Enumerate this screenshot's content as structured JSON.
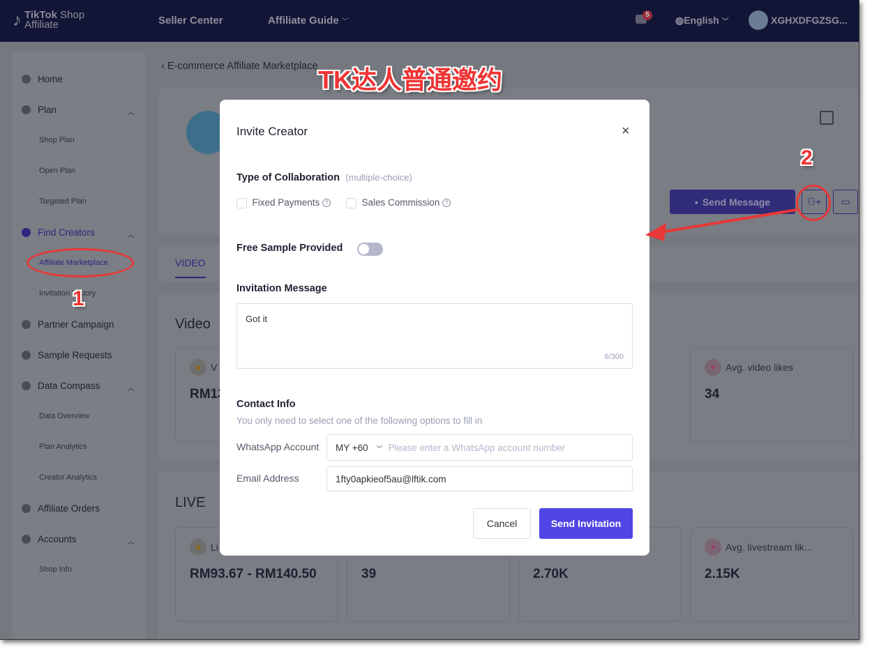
{
  "header": {
    "logo_line1": "TikTok",
    "logo_shop": "Shop",
    "logo_line2": "Affiliate",
    "nav": [
      "Seller Center",
      "Affiliate Guide"
    ],
    "notification_count": "5",
    "language": "English",
    "username": "XGHXDFGZSG..."
  },
  "sidebar": {
    "items": [
      {
        "label": "Home",
        "type": "main"
      },
      {
        "label": "Plan",
        "type": "main",
        "expanded": true
      },
      {
        "label": "Shop Plan",
        "type": "sub"
      },
      {
        "label": "Open Plan",
        "type": "sub"
      },
      {
        "label": "Targeted Plan",
        "type": "sub"
      },
      {
        "label": "Find Creators",
        "type": "main",
        "expanded": true,
        "active": true
      },
      {
        "label": "Affiliate Marketplace",
        "type": "sub",
        "active": true
      },
      {
        "label": "Invitation History",
        "type": "sub"
      },
      {
        "label": "Partner Campaign",
        "type": "main"
      },
      {
        "label": "Sample Requests",
        "type": "main"
      },
      {
        "label": "Data Compass",
        "type": "main",
        "expanded": true
      },
      {
        "label": "Data Overview",
        "type": "sub"
      },
      {
        "label": "Plan Analytics",
        "type": "sub"
      },
      {
        "label": "Creator Analytics",
        "type": "sub"
      },
      {
        "label": "Affiliate Orders",
        "type": "main"
      },
      {
        "label": "Accounts",
        "type": "main",
        "expanded": true
      },
      {
        "label": "Shop Info",
        "type": "sub"
      }
    ]
  },
  "main": {
    "breadcrumb": "E-commerce Affiliate Marketplace",
    "send_message": "Send Message",
    "tab_video": "VIDEO",
    "video": {
      "title": "Video",
      "stats": [
        {
          "label": "V",
          "value": "RM13"
        },
        {
          "label": "Avg. video likes",
          "value": "34"
        }
      ]
    },
    "live": {
      "title": "LIVE",
      "stats": [
        {
          "label": "Li",
          "value": "RM93.67 - RM140.50"
        },
        {
          "label": "",
          "value": "39"
        },
        {
          "label": "",
          "value": "2.70K"
        },
        {
          "label": "Avg. livestream lik...",
          "value": "2.15K"
        }
      ]
    }
  },
  "modal": {
    "title": "Invite Creator",
    "collab_label": "Type of Collaboration",
    "collab_hint": "(multiple-choice)",
    "options": [
      {
        "label": "Fixed Payments",
        "checked": false
      },
      {
        "label": "Sales Commission",
        "checked": false
      }
    ],
    "free_sample_label": "Free Sample Provided",
    "free_sample_on": false,
    "message_label": "Invitation Message",
    "message_value": "Got it",
    "message_count": "6/300",
    "contact_label": "Contact Info",
    "contact_hint": "You only need to select one of the following options to fill in",
    "whatsapp_label": "WhatsApp Account",
    "country_code": "MY +60",
    "whatsapp_placeholder": "Please enter a WhatsApp account number",
    "email_label": "Email Address",
    "email_value": "1fty0apkieof5au@lftik.com",
    "cancel": "Cancel",
    "send": "Send Invitation"
  },
  "annotations": {
    "title": "TK达人普通邀约",
    "step1": "1",
    "step2": "2"
  },
  "colors": {
    "accent": "#5046e5",
    "header_bg": "#121536",
    "annotation": "#f03434"
  }
}
